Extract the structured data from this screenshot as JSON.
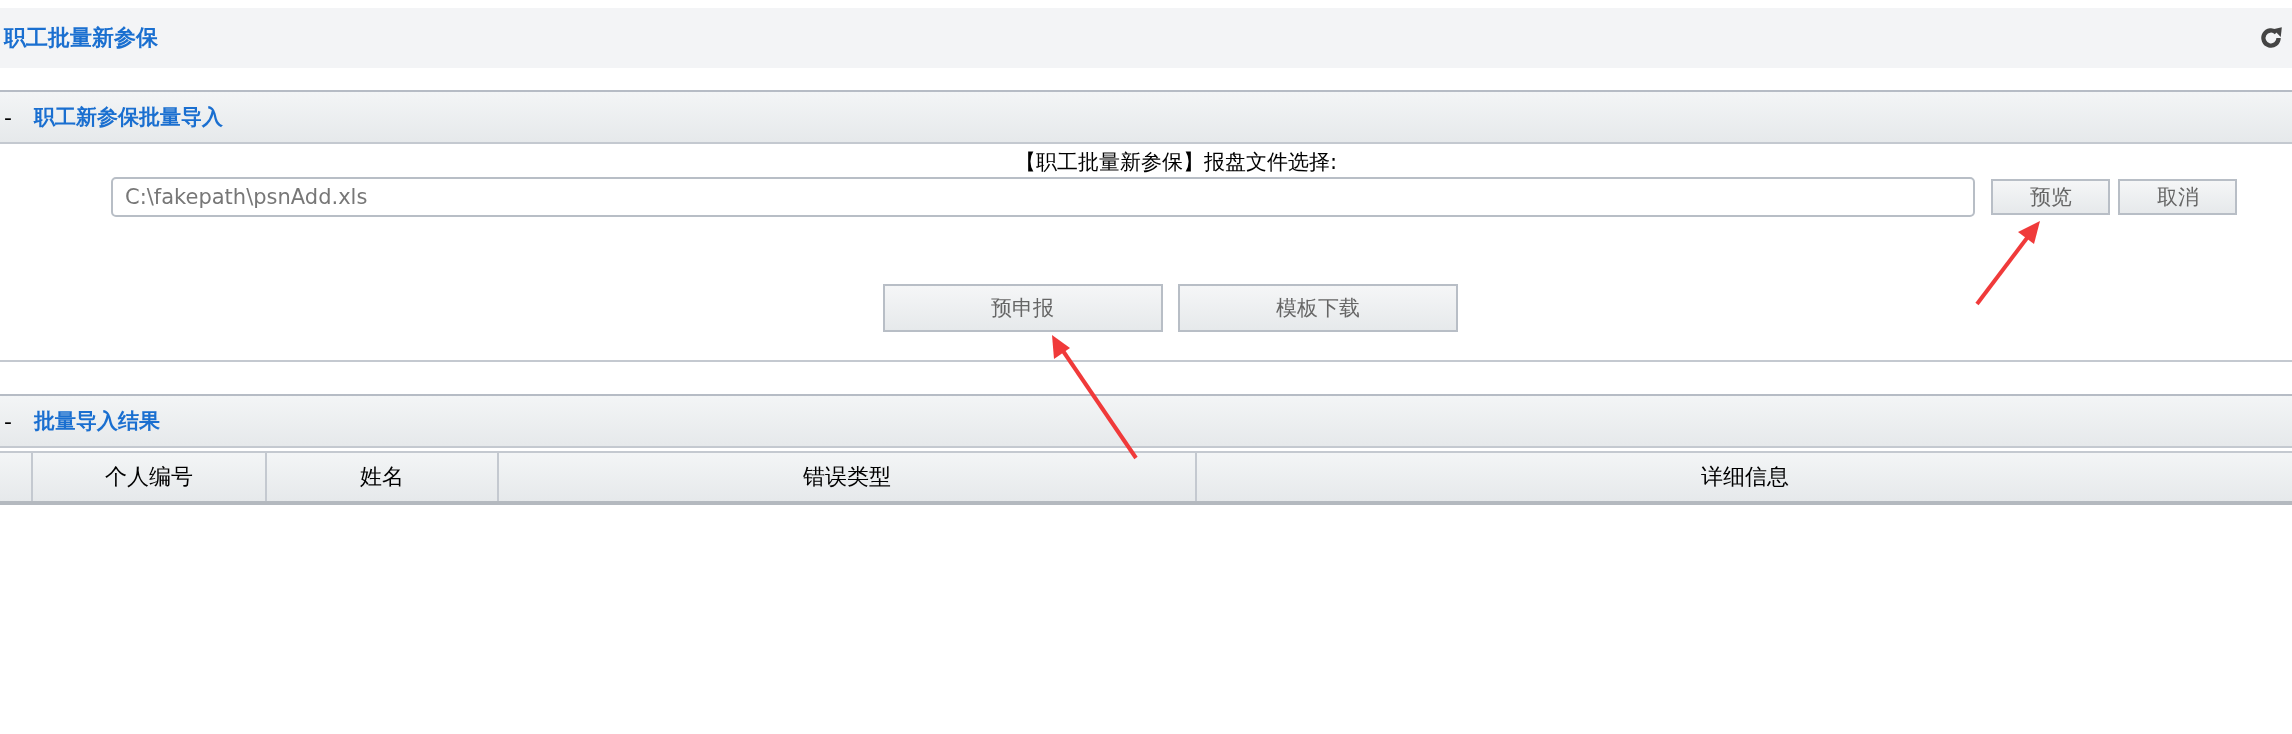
{
  "page_title": "职工批量新参保",
  "import_section": {
    "toggle": "-",
    "title": "职工新参保批量导入",
    "file_label": "【职工批量新参保】报盘文件选择:",
    "file_path": "C:\\fakepath\\psnAdd.xls",
    "side_buttons": [
      "预览",
      "取消"
    ],
    "action_buttons": [
      "预申报",
      "模板下载"
    ]
  },
  "result_section": {
    "toggle": "-",
    "title": "批量导入结果",
    "table": {
      "columns": [
        "个人编号",
        "姓名",
        "错误类型",
        "详细信息"
      ]
    }
  }
}
